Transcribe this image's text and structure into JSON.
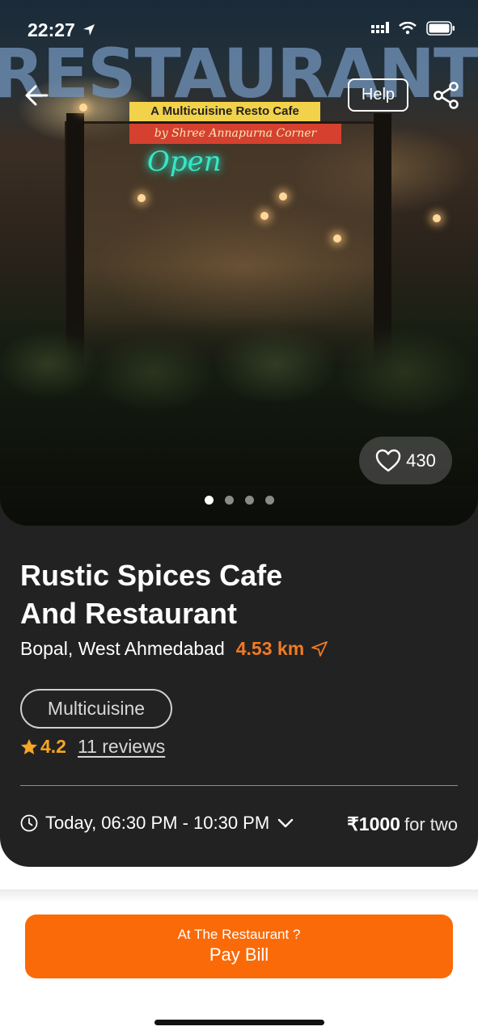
{
  "status_bar": {
    "time": "22:27"
  },
  "hero": {
    "sign_text": "RESTAURANT",
    "banner_line1": "A Multicuisine Resto Cafe",
    "banner_line2": "by Shree Annapurna Corner",
    "neon_sign": "Open",
    "help_label": "Help",
    "like_count": "430",
    "carousel": {
      "count": 4,
      "active_index": 0
    }
  },
  "restaurant": {
    "name_line1": "Rustic Spices Cafe",
    "name_line2": "And Restaurant",
    "location": "Bopal, West Ahmedabad",
    "distance": "4.53 km",
    "cuisine": "Multicuisine",
    "rating": "4.2",
    "reviews": "11 reviews",
    "hours": "Today, 06:30 PM - 10:30 PM",
    "price": "₹1000",
    "price_suffix": "for two"
  },
  "cta": {
    "subtitle": "At The Restaurant ?",
    "label": "Pay Bill"
  },
  "colors": {
    "accent": "#fb6a08",
    "distance": "#f07a24",
    "star": "#f5a623",
    "card_bg": "#222222"
  },
  "icons": [
    "location-arrow-icon",
    "cellular-icon",
    "wifi-icon",
    "battery-icon",
    "back-arrow-icon",
    "share-icon",
    "heart-icon",
    "navigation-icon",
    "star-icon",
    "clock-icon",
    "chevron-down-icon"
  ]
}
